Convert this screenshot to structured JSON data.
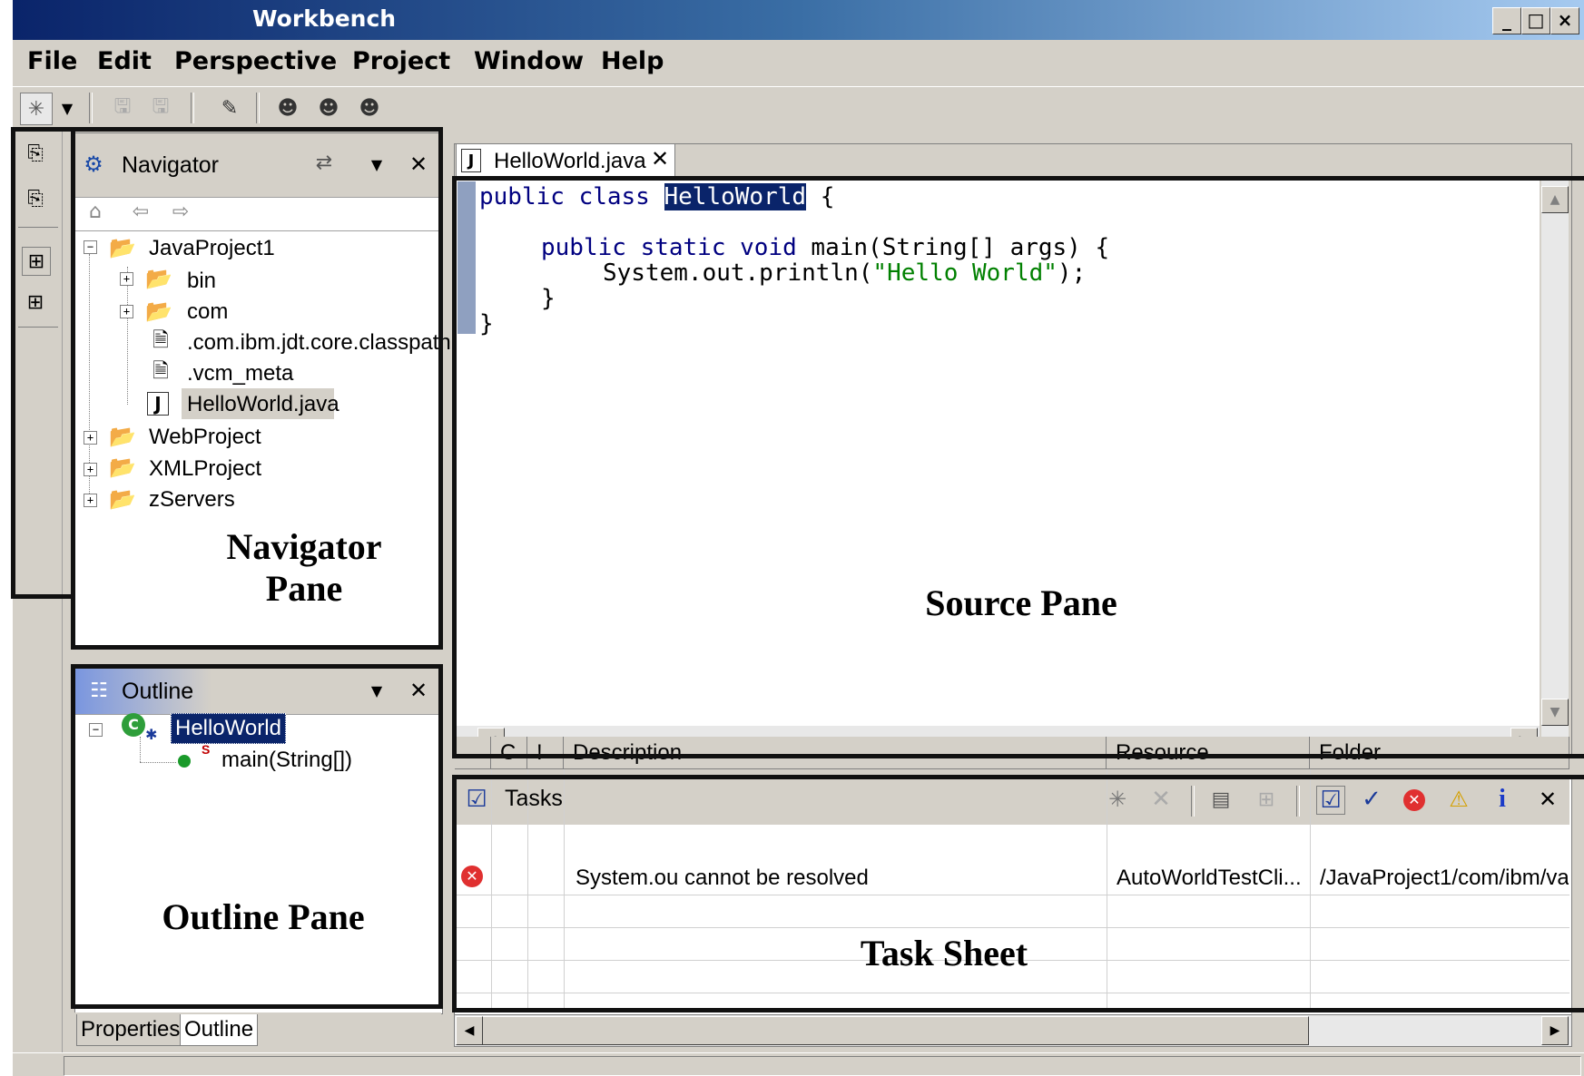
{
  "window": {
    "title": "Workbench",
    "controls": [
      "_",
      "□",
      "×"
    ]
  },
  "menu": [
    "File",
    "Edit",
    "Perspective",
    "Project",
    "Window",
    "Help"
  ],
  "navigator": {
    "title": "Navigator",
    "tree": [
      {
        "label": "JavaProject1",
        "icon": "folder-icon",
        "expander": "−"
      },
      {
        "label": "bin",
        "icon": "folder-icon",
        "expander": "+"
      },
      {
        "label": "com",
        "icon": "folder-icon",
        "expander": "+"
      },
      {
        "label": ".com.ibm.jdt.core.classpath",
        "icon": "file-icon"
      },
      {
        "label": ".vcm_meta",
        "icon": "file-icon"
      },
      {
        "label": "HelloWorld.java",
        "icon": "java-file-icon"
      },
      {
        "label": "WebProject",
        "icon": "folder-icon",
        "expander": "+"
      },
      {
        "label": "XMLProject",
        "icon": "folder-icon",
        "expander": "+"
      },
      {
        "label": "zServers",
        "icon": "folder-icon",
        "expander": "+"
      }
    ]
  },
  "outline": {
    "title": "Outline",
    "class_name": "HelloWorld",
    "method": "main(String[])",
    "method_marker": "S"
  },
  "bottom_tabs": [
    "Properties",
    "Outline"
  ],
  "editor": {
    "tab_label": "HelloWorld.java",
    "code": {
      "l1_kw": "public class ",
      "l1_sel": "HelloWorld",
      "l1_rest": " {",
      "l2_kw": "public static void ",
      "l2_rest": "main(String[] args) {",
      "l3_pre": "System.out.println(",
      "l3_str": "\"Hello World\"",
      "l3_post": ");",
      "l4": "}",
      "l5": "}"
    }
  },
  "tasks": {
    "title": "Tasks",
    "columns": [
      "C",
      "!",
      "Description",
      "Resource",
      "Folder"
    ],
    "rows": [
      {
        "description": "System.ou cannot be resolved",
        "resource": "AutoWorldTestCli...",
        "folder": "/JavaProject1/com/ibm/va"
      }
    ]
  },
  "annotations": {
    "navigator": "Navigator\nPane",
    "source": "Source Pane",
    "outline": "Outline Pane",
    "tasks": "Task Sheet"
  },
  "colors": {
    "title_start": "#0a246a",
    "title_end": "#a6caf0",
    "chrome": "#d4d0c8",
    "keyword": "#000080",
    "string": "#008000",
    "error": "#e03030"
  }
}
